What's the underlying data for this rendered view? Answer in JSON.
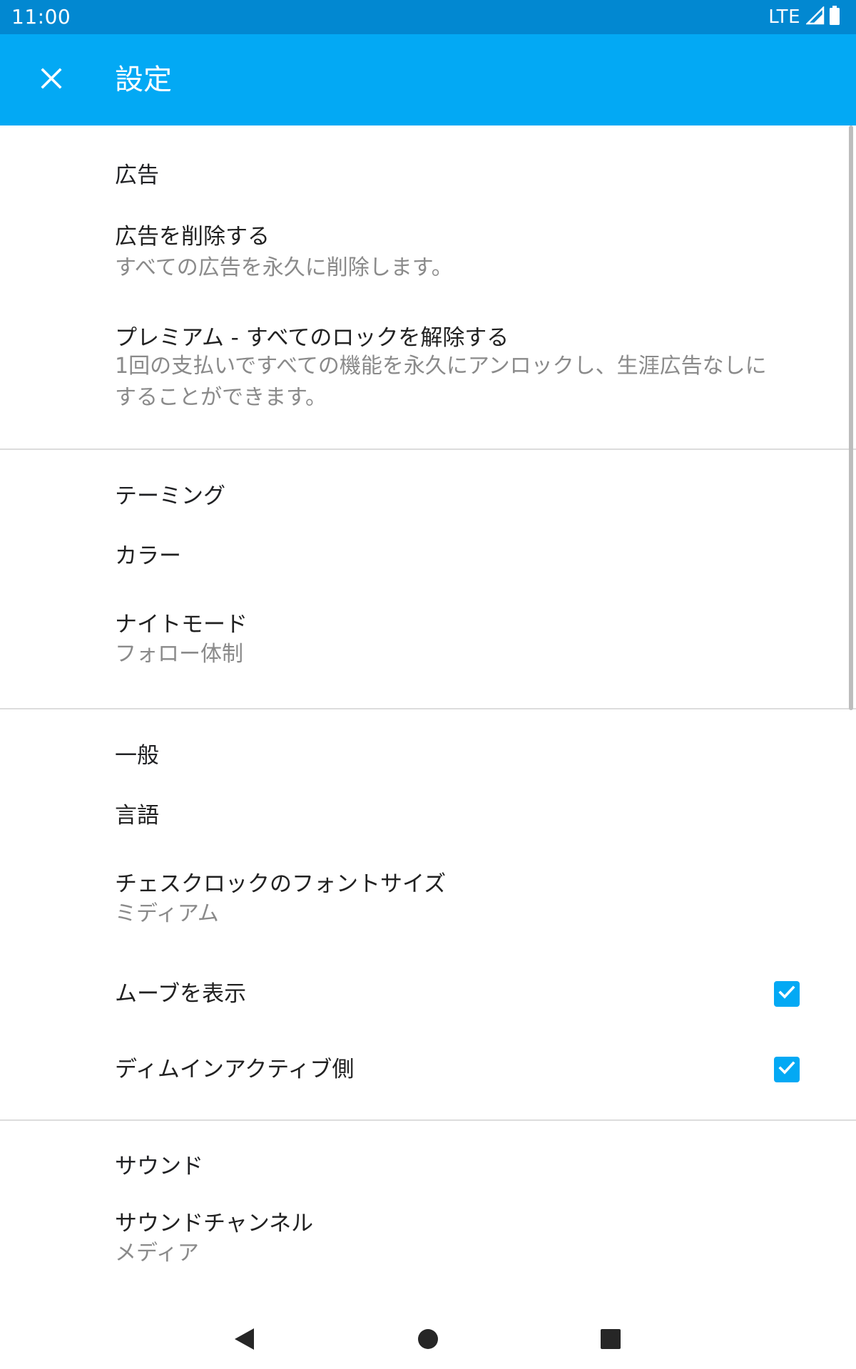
{
  "status_bar": {
    "time": "11:00",
    "network": "LTE"
  },
  "app_bar": {
    "title": "設定",
    "close_icon": "close-icon"
  },
  "sections": {
    "ads": {
      "header": "広告",
      "remove_ads": {
        "title": "広告を削除する",
        "summary": "すべての広告を永久に削除します。"
      },
      "premium": {
        "title": "プレミアム - すべてのロックを解除する",
        "summary_line1": "1回の支払いですべての機能を永久にアンロックし、生涯広告なしに",
        "summary_line2": "することができます。"
      }
    },
    "theming": {
      "header": "テーミング",
      "color": {
        "title": "カラー"
      },
      "night_mode": {
        "title": "ナイトモード",
        "summary": "フォロー体制"
      }
    },
    "general": {
      "header": "一般",
      "language": {
        "title": "言語"
      },
      "font_size": {
        "title": "チェスクロックのフォントサイズ",
        "summary": "ミディアム"
      },
      "show_moves": {
        "title": "ムーブを表示",
        "checked": true
      },
      "dim_inactive": {
        "title": "ディムインアクティブ側",
        "checked": true
      }
    },
    "sound": {
      "header": "サウンド",
      "channel": {
        "title": "サウンドチャンネル",
        "summary": "メディア"
      }
    }
  },
  "colors": {
    "status_bar": "#0288d1",
    "app_bar": "#03a9f4",
    "accent": "#03a9f4",
    "divider": "#dcdcdc"
  },
  "nav_bar": {
    "back_icon": "back-triangle-icon",
    "home_icon": "home-circle-icon",
    "recents_icon": "recents-square-icon"
  }
}
